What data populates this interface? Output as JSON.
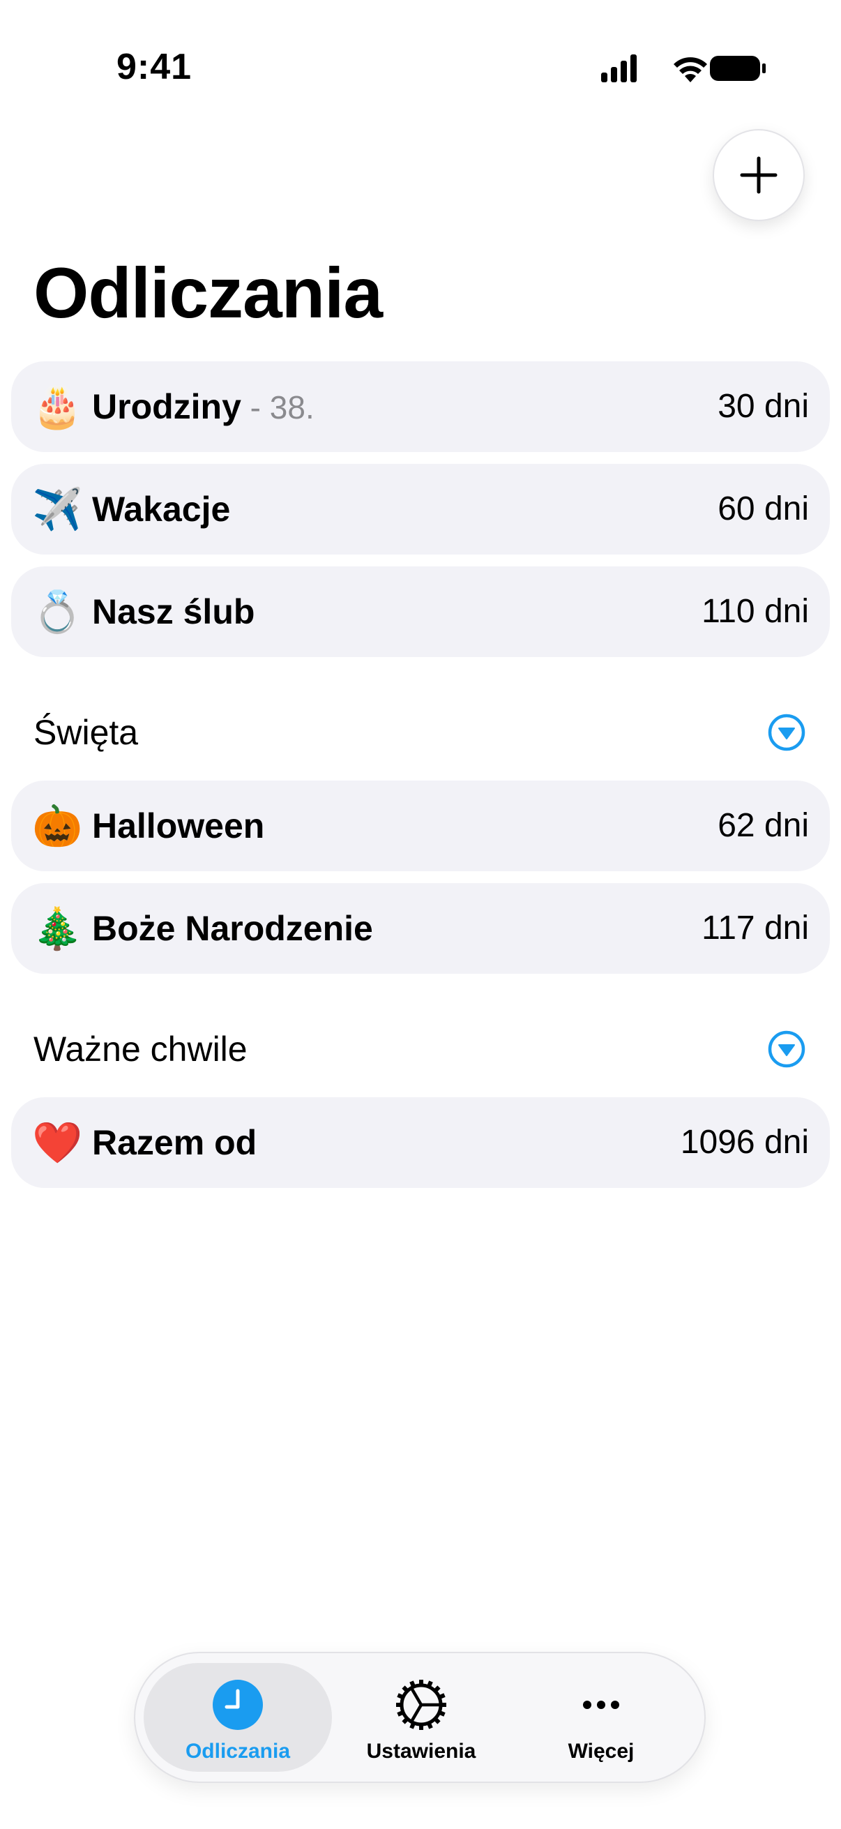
{
  "status_bar": {
    "time": "9:41"
  },
  "header": {
    "add_icon": "plus-icon",
    "title": "Odliczania"
  },
  "countdowns": [
    {
      "emoji": "🎂",
      "title": "Urodziny",
      "subtitle": " - 38.",
      "days": "30 dni"
    },
    {
      "emoji": "✈️",
      "title": "Wakacje",
      "subtitle": "",
      "days": "60 dni"
    },
    {
      "emoji": "💍",
      "title": "Nasz ślub",
      "subtitle": "",
      "days": "110 dni"
    }
  ],
  "sections": [
    {
      "title": "Święta",
      "icon": "chevron-down-circle-icon",
      "items": [
        {
          "emoji": "🎃",
          "title": "Halloween",
          "days": "62 dni"
        },
        {
          "emoji": "🎄",
          "title": "Boże Narodzenie",
          "days": "117 dni"
        }
      ]
    },
    {
      "title": "Ważne chwile",
      "icon": "chevron-down-circle-icon",
      "items": [
        {
          "emoji": "❤️",
          "title": "Razem od",
          "days": "1096 dni"
        }
      ]
    }
  ],
  "tab_bar": {
    "tabs": [
      {
        "label": "Odliczania",
        "icon": "clock-icon",
        "active": true
      },
      {
        "label": "Ustawienia",
        "icon": "gear-icon",
        "active": false
      },
      {
        "label": "Więcej",
        "icon": "ellipsis-icon",
        "active": false
      }
    ]
  },
  "colors": {
    "accent": "#1a9cf0",
    "row_background": "#f2f2f7",
    "secondary_text": "#8a8a8e"
  }
}
